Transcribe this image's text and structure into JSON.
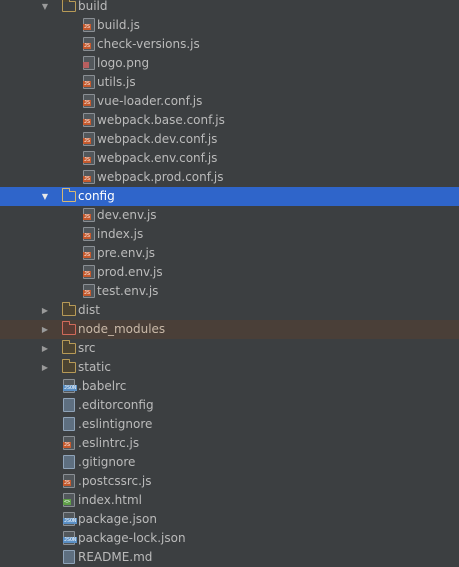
{
  "project_tree": {
    "items": [
      {
        "name": "build",
        "kind": "folder",
        "expanded": true,
        "depth": 0,
        "state": "normal",
        "icon": "folder-open-icon"
      },
      {
        "name": "build.js",
        "kind": "file",
        "type": "js",
        "depth": 1,
        "icon": "js-file-icon"
      },
      {
        "name": "check-versions.js",
        "kind": "file",
        "type": "js",
        "depth": 1,
        "icon": "js-file-icon"
      },
      {
        "name": "logo.png",
        "kind": "file",
        "type": "img",
        "depth": 1,
        "icon": "image-file-icon"
      },
      {
        "name": "utils.js",
        "kind": "file",
        "type": "js",
        "depth": 1,
        "icon": "js-file-icon"
      },
      {
        "name": "vue-loader.conf.js",
        "kind": "file",
        "type": "js",
        "depth": 1,
        "icon": "js-file-icon"
      },
      {
        "name": "webpack.base.conf.js",
        "kind": "file",
        "type": "js",
        "depth": 1,
        "icon": "js-file-icon"
      },
      {
        "name": "webpack.dev.conf.js",
        "kind": "file",
        "type": "js",
        "depth": 1,
        "icon": "js-file-icon"
      },
      {
        "name": "webpack.env.conf.js",
        "kind": "file",
        "type": "js",
        "depth": 1,
        "icon": "js-file-icon"
      },
      {
        "name": "webpack.prod.conf.js",
        "kind": "file",
        "type": "js",
        "depth": 1,
        "icon": "js-file-icon"
      },
      {
        "name": "config",
        "kind": "folder",
        "expanded": true,
        "depth": 0,
        "state": "selected",
        "icon": "folder-open-icon"
      },
      {
        "name": "dev.env.js",
        "kind": "file",
        "type": "js",
        "depth": 1,
        "icon": "js-file-icon"
      },
      {
        "name": "index.js",
        "kind": "file",
        "type": "js",
        "depth": 1,
        "icon": "js-file-icon"
      },
      {
        "name": "pre.env.js",
        "kind": "file",
        "type": "js",
        "depth": 1,
        "icon": "js-file-icon"
      },
      {
        "name": "prod.env.js",
        "kind": "file",
        "type": "js",
        "depth": 1,
        "icon": "js-file-icon"
      },
      {
        "name": "test.env.js",
        "kind": "file",
        "type": "js",
        "depth": 1,
        "icon": "js-file-icon"
      },
      {
        "name": "dist",
        "kind": "folder",
        "expanded": false,
        "depth": 0,
        "state": "normal",
        "icon": "folder-icon"
      },
      {
        "name": "node_modules",
        "kind": "folder",
        "expanded": false,
        "depth": 0,
        "state": "excluded",
        "icon": "excluded-folder-icon"
      },
      {
        "name": "src",
        "kind": "folder",
        "expanded": false,
        "depth": 0,
        "state": "normal",
        "icon": "folder-icon"
      },
      {
        "name": "static",
        "kind": "folder",
        "expanded": false,
        "depth": 0,
        "state": "normal",
        "icon": "folder-icon"
      },
      {
        "name": ".babelrc",
        "kind": "file",
        "type": "json",
        "depth": 0,
        "icon": "json-file-icon"
      },
      {
        "name": ".editorconfig",
        "kind": "file",
        "type": "text",
        "depth": 0,
        "icon": "text-file-icon"
      },
      {
        "name": ".eslintignore",
        "kind": "file",
        "type": "text",
        "depth": 0,
        "icon": "text-file-icon"
      },
      {
        "name": ".eslintrc.js",
        "kind": "file",
        "type": "js",
        "depth": 0,
        "icon": "js-file-icon"
      },
      {
        "name": ".gitignore",
        "kind": "file",
        "type": "text",
        "depth": 0,
        "icon": "text-file-icon"
      },
      {
        "name": ".postcssrc.js",
        "kind": "file",
        "type": "js",
        "depth": 0,
        "icon": "js-file-icon"
      },
      {
        "name": "index.html",
        "kind": "file",
        "type": "html",
        "depth": 0,
        "icon": "html-file-icon"
      },
      {
        "name": "package.json",
        "kind": "file",
        "type": "json",
        "depth": 0,
        "icon": "json-file-icon"
      },
      {
        "name": "package-lock.json",
        "kind": "file",
        "type": "json",
        "depth": 0,
        "icon": "json-file-icon"
      },
      {
        "name": "README.md",
        "kind": "file",
        "type": "text",
        "depth": 0,
        "icon": "markdown-file-icon"
      }
    ]
  },
  "colors": {
    "background": "#3c3f41",
    "selection": "#2f65ca",
    "excluded_row": "#4a3f38",
    "text": "#bbbbbb",
    "folder_outline": "#b79a57",
    "js_badge": "#c55a2e",
    "json_badge": "#5a8fc4",
    "html_badge": "#5f9e48"
  }
}
